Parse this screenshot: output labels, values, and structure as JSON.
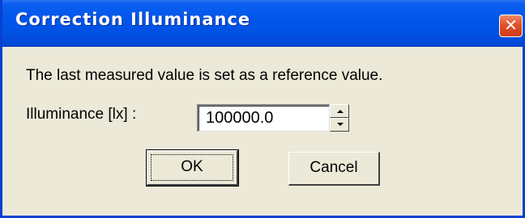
{
  "dialog": {
    "title": "Correction Illuminance",
    "close_glyph": "✕",
    "message": "The last measured value is set as a reference value.",
    "field_label": "Illuminance [lx] :",
    "field_value": "100000.0",
    "ok_label": "OK",
    "cancel_label": "Cancel"
  },
  "icons": {
    "close": "close-icon",
    "spin_up": "chevron-up-icon",
    "spin_down": "chevron-down-icon"
  },
  "colors": {
    "titlebar": "#0055ea",
    "window_border": "#0a3fd0",
    "dialog_bg": "#ece9d8",
    "close_button": "#e0522b"
  }
}
